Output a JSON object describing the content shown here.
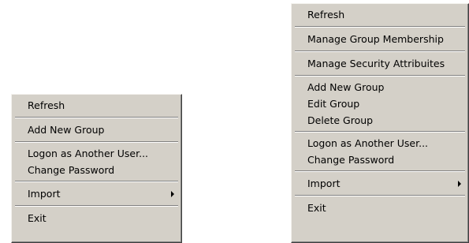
{
  "left_menu": {
    "refresh": "Refresh",
    "add_new_group": "Add New Group",
    "logon_as_another_user": "Logon as Another User...",
    "change_password": "Change Password",
    "import": "Import",
    "exit": "Exit"
  },
  "right_menu": {
    "refresh": "Refresh",
    "manage_group_membership": "Manage Group Membership",
    "manage_security_attributes": "Manage Security Attribuites",
    "add_new_group": "Add New Group",
    "edit_group": "Edit Group",
    "delete_group": "Delete Group",
    "logon_as_another_user": "Logon as Another User...",
    "change_password": "Change Password",
    "import": "Import",
    "exit": "Exit"
  }
}
